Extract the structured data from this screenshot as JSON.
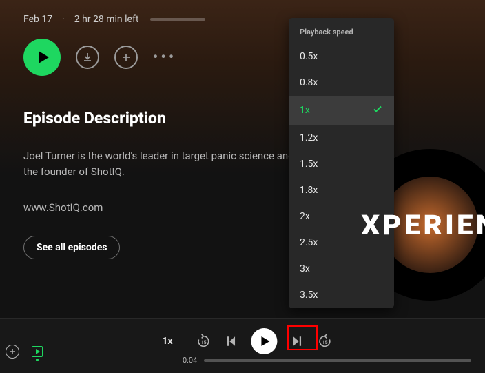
{
  "meta": {
    "date": "Feb 17",
    "sep": "·",
    "remaining": "2 hr 28 min left"
  },
  "section_title": "Episode Description",
  "description": "Joel Turner is the world's leader in target panic science and the founder of ShotIQ.",
  "link": "www.ShotIQ.com",
  "see_all": "See all episodes",
  "artwork_text": "XPERIEN",
  "menu": {
    "title": "Playback speed",
    "items": [
      "0.5x",
      "0.8x",
      "1x",
      "1.2x",
      "1.5x",
      "1.8x",
      "2x",
      "2.5x",
      "3x",
      "3.5x"
    ],
    "selected": "1x"
  },
  "player": {
    "speed_label": "1x",
    "skip_back": "15",
    "skip_fwd": "15",
    "elapsed": "0:04"
  }
}
